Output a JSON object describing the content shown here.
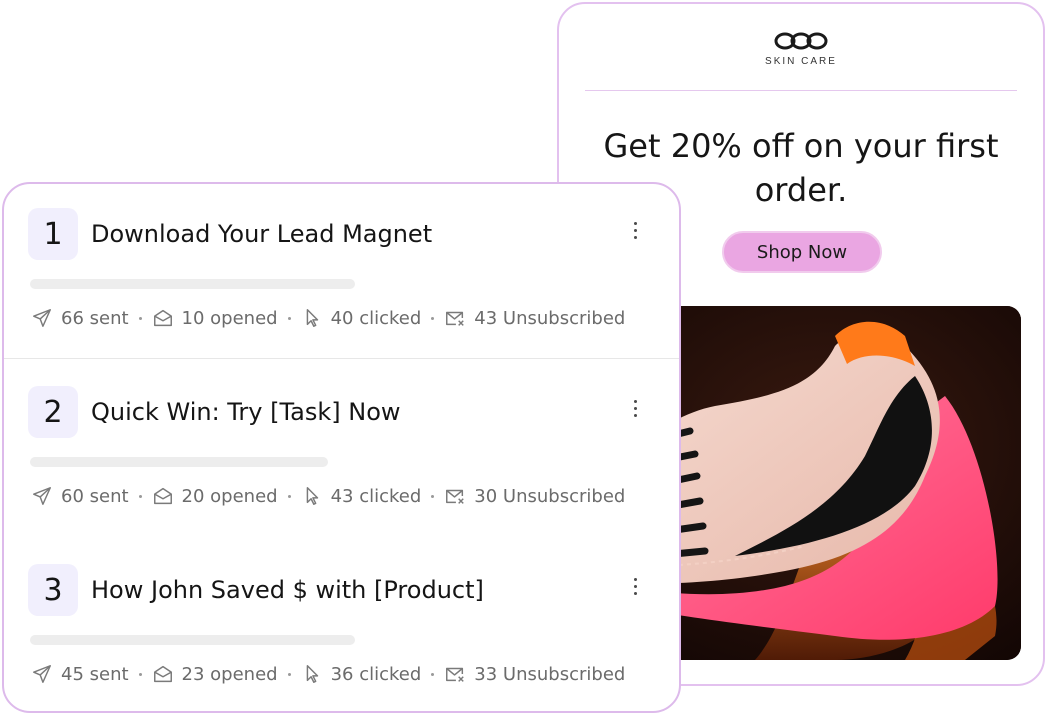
{
  "email_preview": {
    "brand_logo_icon": "infinity-loop-logo",
    "brand_name": "SKIN CARE",
    "offer_text": "Get 20% off on your first order.",
    "cta_label": "Shop Now",
    "cta_color": "#eaa6e2",
    "hero_image": "sneaker-product-photo"
  },
  "sequence": {
    "steps": [
      {
        "number": "1",
        "title": "Download Your Lead Magnet",
        "sent": "66 sent",
        "opened": "10 opened",
        "clicked": "40 clicked",
        "unsubscribed": "43 Unsubscribed"
      },
      {
        "number": "2",
        "title": "Quick Win: Try [Task] Now",
        "sent": "60 sent",
        "opened": "20 opened",
        "clicked": "43 clicked",
        "unsubscribed": "30 Unsubscribed"
      },
      {
        "number": "3",
        "title": "How John Saved $ with [Product]",
        "sent": "45 sent",
        "opened": "23 opened",
        "clicked": "36 clicked",
        "unsubscribed": "33 Unsubscribed"
      }
    ],
    "icons": {
      "sent": "send-icon",
      "opened": "open-envelope-icon",
      "clicked": "cursor-click-icon",
      "unsubscribed": "mail-x-icon",
      "menu": "kebab-menu-icon"
    },
    "accent_colors": {
      "border": "#ddbaeb",
      "number_bg": "#f1effd"
    }
  }
}
